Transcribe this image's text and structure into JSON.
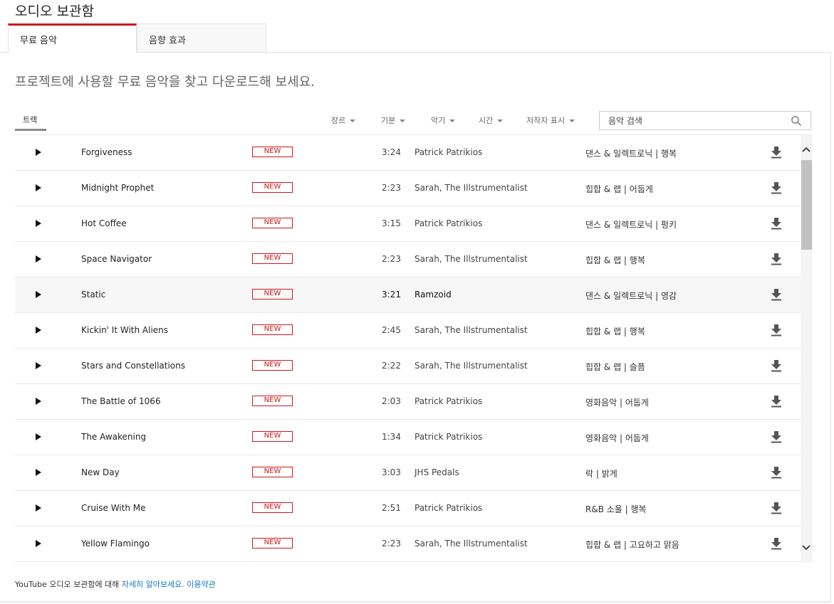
{
  "page": {
    "title": "오디오 보관함"
  },
  "tabs": [
    {
      "label": "무료 음악",
      "active": true
    },
    {
      "label": "음향 효과",
      "active": false
    }
  ],
  "subtitle": "프로젝트에 사용할 무료 음악을 찾고 다운로드해 보세요.",
  "filters": {
    "tracks_label": "트랙",
    "genre": "장르",
    "mood": "기분",
    "instrument": "악기",
    "duration": "시간",
    "attribution": "저작자 표시"
  },
  "search": {
    "placeholder": "음악 검색"
  },
  "tracks": [
    {
      "title": "Forgiveness",
      "badge": "NEW",
      "duration": "3:24",
      "artist": "Patrick Patrikios",
      "genre": "댄스 & 일렉트로닉 | 행복"
    },
    {
      "title": "Midnight Prophet",
      "badge": "NEW",
      "duration": "2:23",
      "artist": "Sarah, The Illstrumentalist",
      "genre": "힙합 & 랩 | 어둡게"
    },
    {
      "title": "Hot Coffee",
      "badge": "NEW",
      "duration": "3:15",
      "artist": "Patrick Patrikios",
      "genre": "댄스 & 일렉트로닉 | 펑키"
    },
    {
      "title": "Space Navigator",
      "badge": "NEW",
      "duration": "2:23",
      "artist": "Sarah, The Illstrumentalist",
      "genre": "힙합 & 랩 | 행복"
    },
    {
      "title": "Static",
      "badge": "NEW",
      "duration": "3:21",
      "artist": "Ramzoid",
      "genre": "댄스 & 일렉트로닉 | 영감",
      "hover": true
    },
    {
      "title": "Kickin' It With Aliens",
      "badge": "NEW",
      "duration": "2:45",
      "artist": "Sarah, The Illstrumentalist",
      "genre": "힙합 & 랩 | 행복"
    },
    {
      "title": "Stars and Constellations",
      "badge": "NEW",
      "duration": "2:22",
      "artist": "Sarah, The Illstrumentalist",
      "genre": "힙합 & 랩 | 슬픔"
    },
    {
      "title": "The Battle of 1066",
      "badge": "NEW",
      "duration": "2:03",
      "artist": "Patrick Patrikios",
      "genre": "영화음악 | 어둡게"
    },
    {
      "title": "The Awakening",
      "badge": "NEW",
      "duration": "1:34",
      "artist": "Patrick Patrikios",
      "genre": "영화음악 | 어둡게"
    },
    {
      "title": "New Day",
      "badge": "NEW",
      "duration": "3:03",
      "artist": "JHS Pedals",
      "genre": "락 | 밝게"
    },
    {
      "title": "Cruise With Me",
      "badge": "NEW",
      "duration": "2:51",
      "artist": "Patrick Patrikios",
      "genre": "R&B 소울 | 행복"
    },
    {
      "title": "Yellow Flamingo",
      "badge": "NEW",
      "duration": "2:23",
      "artist": "Sarah, The Illstrumentalist",
      "genre": "힙합 & 랩 | 고요하고 맑음"
    }
  ],
  "footer": {
    "text": "YouTube 오디오 보관함에 대해 ",
    "learn_more": "자세히 알아보세요.",
    "terms": "이용약관"
  },
  "colors": {
    "accent_red": "#cc181e",
    "link_blue": "#167ac6"
  }
}
